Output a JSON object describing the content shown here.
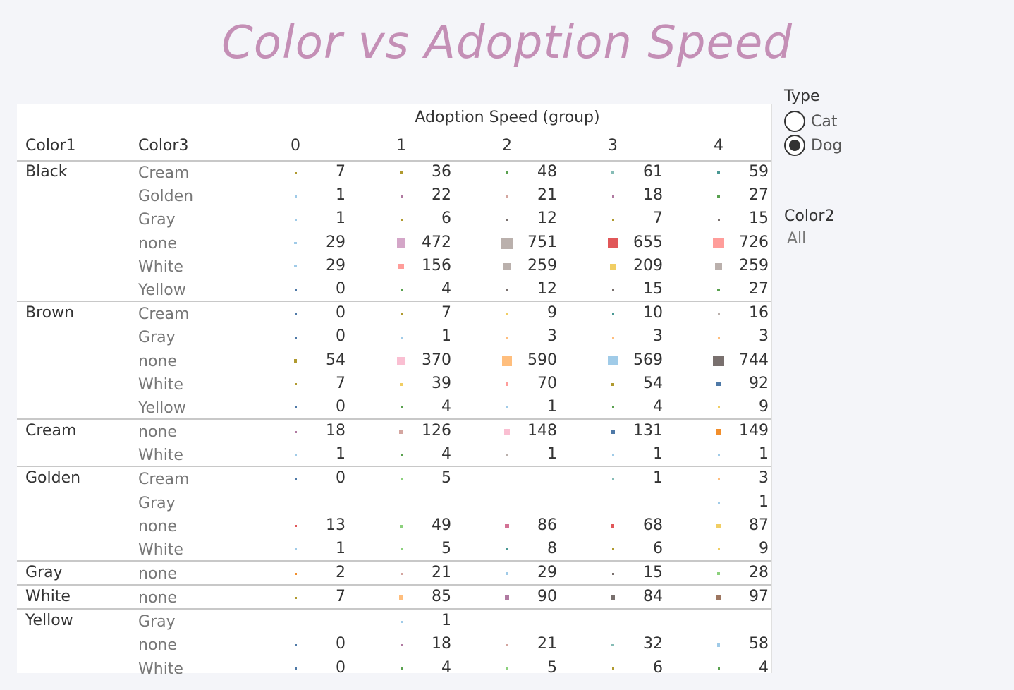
{
  "title": "Color vs Adoption Speed",
  "legend": {
    "type_title": "Type",
    "type_options": [
      {
        "label": "Cat",
        "selected": false
      },
      {
        "label": "Dog",
        "selected": true
      }
    ],
    "color2_title": "Color2",
    "color2_value": "All"
  },
  "chart_data": {
    "type": "table",
    "column_group_label": "Adoption Speed (group)",
    "row_header_1": "Color1",
    "row_header_2": "Color3",
    "columns": [
      "0",
      "1",
      "2",
      "3",
      "4"
    ],
    "groups": [
      {
        "color1": "Black",
        "rows": [
          {
            "color3": "Cream",
            "values": [
              7,
              36,
              48,
              61,
              59
            ]
          },
          {
            "color3": "Golden",
            "values": [
              1,
              22,
              21,
              18,
              27
            ]
          },
          {
            "color3": "Gray",
            "values": [
              1,
              6,
              12,
              7,
              15
            ]
          },
          {
            "color3": "none",
            "values": [
              29,
              472,
              751,
              655,
              726
            ]
          },
          {
            "color3": "White",
            "values": [
              29,
              156,
              259,
              209,
              259
            ]
          },
          {
            "color3": "Yellow",
            "values": [
              0,
              4,
              12,
              15,
              27
            ]
          }
        ]
      },
      {
        "color1": "Brown",
        "rows": [
          {
            "color3": "Cream",
            "values": [
              0,
              7,
              9,
              10,
              16
            ]
          },
          {
            "color3": "Gray",
            "values": [
              0,
              1,
              3,
              3,
              3
            ]
          },
          {
            "color3": "none",
            "values": [
              54,
              370,
              590,
              569,
              744
            ]
          },
          {
            "color3": "White",
            "values": [
              7,
              39,
              70,
              54,
              92
            ]
          },
          {
            "color3": "Yellow",
            "values": [
              0,
              4,
              1,
              4,
              9
            ]
          }
        ]
      },
      {
        "color1": "Cream",
        "rows": [
          {
            "color3": "none",
            "values": [
              18,
              126,
              148,
              131,
              149
            ]
          },
          {
            "color3": "White",
            "values": [
              1,
              4,
              1,
              1,
              1
            ]
          }
        ]
      },
      {
        "color1": "Golden",
        "rows": [
          {
            "color3": "Cream",
            "values": [
              0,
              5,
              null,
              1,
              3
            ]
          },
          {
            "color3": "Gray",
            "values": [
              null,
              null,
              null,
              null,
              1
            ]
          },
          {
            "color3": "none",
            "values": [
              13,
              49,
              86,
              68,
              87
            ]
          },
          {
            "color3": "White",
            "values": [
              1,
              5,
              8,
              6,
              9
            ]
          }
        ]
      },
      {
        "color1": "Gray",
        "rows": [
          {
            "color3": "none",
            "values": [
              2,
              21,
              29,
              15,
              28
            ]
          }
        ]
      },
      {
        "color1": "White",
        "rows": [
          {
            "color3": "none",
            "values": [
              7,
              85,
              90,
              84,
              97
            ]
          }
        ]
      },
      {
        "color1": "Yellow",
        "rows": [
          {
            "color3": "Gray",
            "values": [
              null,
              1,
              null,
              null,
              null
            ]
          },
          {
            "color3": "none",
            "values": [
              0,
              18,
              21,
              32,
              58
            ]
          },
          {
            "color3": "White",
            "values": [
              0,
              4,
              5,
              6,
              4
            ]
          }
        ]
      }
    ],
    "marker_colors": [
      [
        "#b09a2f",
        "#b09a2f",
        "#59a14f",
        "#86bcb6",
        "#499894"
      ],
      [
        "#a0cbe8",
        "#b07aa1",
        "#d4a6a0",
        "#b07aa1",
        "#59a14f"
      ],
      [
        "#a0cbe8",
        "#b09a2f",
        "#79706e",
        "#b09a2f",
        "#79706e"
      ],
      [
        "#a0cbe8",
        "#d4a6c8",
        "#bab0ac",
        "#e15759",
        "#ff9d9a"
      ],
      [
        "#a0cbe8",
        "#ff9d9a",
        "#bab0ac",
        "#f1ce63",
        "#bab0ac"
      ],
      [
        "#4e79a7",
        "#59a14f",
        "#79706e",
        "#79706e",
        "#59a14f"
      ],
      [
        "#4e79a7",
        "#b09a2f",
        "#f1ce63",
        "#499894",
        "#bab0ac"
      ],
      [
        "#4e79a7",
        "#a0cbe8",
        "#ffbe7d",
        "#ffbe7d",
        "#ffbe7d"
      ],
      [
        "#b09a2f",
        "#fabfd2",
        "#ffbe7d",
        "#a0cbe8",
        "#79706e"
      ],
      [
        "#b09a2f",
        "#f1ce63",
        "#ff9d9a",
        "#b09a2f",
        "#4e79a7"
      ],
      [
        "#4e79a7",
        "#59a14f",
        "#a0cbe8",
        "#59a14f",
        "#f1ce63"
      ],
      [
        "#b07aa1",
        "#d4a6a0",
        "#fabfd2",
        "#4e79a7",
        "#f28e2b"
      ],
      [
        "#a0cbe8",
        "#59a14f",
        "#bab0ac",
        "#a0cbe8",
        "#a0cbe8"
      ],
      [
        "#4e79a7",
        "#8cd17d",
        null,
        "#86bcb6",
        "#ffbe7d"
      ],
      [
        null,
        null,
        null,
        null,
        "#a0cbe8"
      ],
      [
        "#e15759",
        "#8cd17d",
        "#d37295",
        "#e15759",
        "#f1ce63"
      ],
      [
        "#a0cbe8",
        "#8cd17d",
        "#499894",
        "#b09a2f",
        "#f1ce63"
      ],
      [
        "#f28e2b",
        "#d4a6a0",
        "#a0cbe8",
        "#79706e",
        "#8cd17d"
      ],
      [
        "#b09a2f",
        "#ffbe7d",
        "#b07aa1",
        "#79706e",
        "#9d7660"
      ],
      [
        null,
        "#a0cbe8",
        null,
        null,
        null
      ],
      [
        "#4e79a7",
        "#b07aa1",
        "#d4a6a0",
        "#86bcb6",
        "#a0cbe8"
      ],
      [
        "#4e79a7",
        "#59a14f",
        "#8cd17d",
        "#b09a2f",
        "#59a14f"
      ]
    ]
  }
}
